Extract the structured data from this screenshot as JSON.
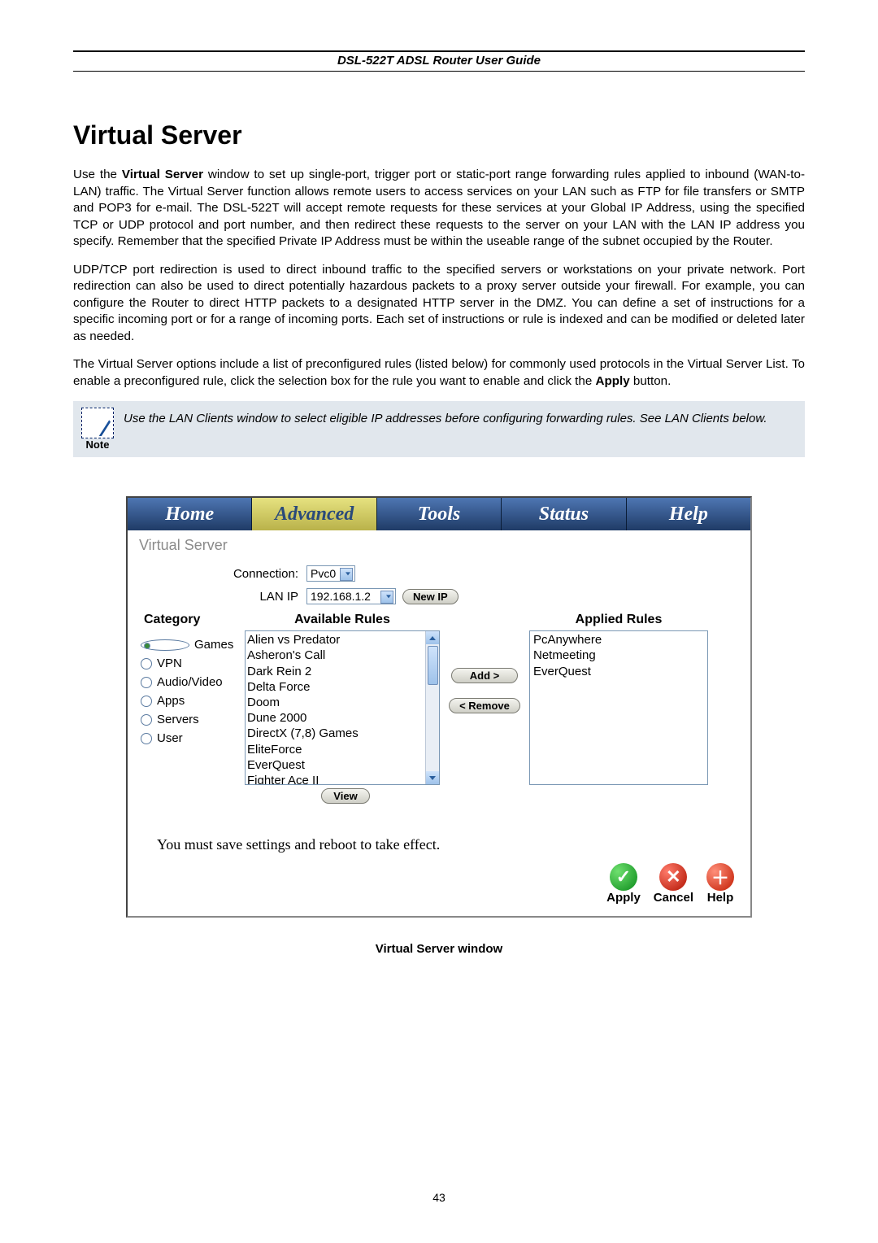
{
  "header": {
    "title": "DSL-522T ADSL Router User Guide"
  },
  "section": {
    "heading": "Virtual Server"
  },
  "paragraphs": {
    "p1a": "Use the ",
    "p1b": "Virtual Server",
    "p1c": " window to set up single-port, trigger port or static-port range forwarding rules applied to inbound (WAN-to-LAN) traffic. The Virtual Server function allows remote users to access services on your LAN such as FTP for file transfers or SMTP and POP3 for e-mail. The DSL-522T will accept remote requests for these services at your Global IP Address, using the specified TCP or UDP protocol and port number, and then redirect these requests to the server on your LAN with the LAN IP address you specify. Remember that the specified Private IP Address must be within the useable range of the subnet occupied by the Router.",
    "p2": "UDP/TCP port redirection is used to direct inbound traffic to the specified servers or workstations on your private network. Port redirection can also be used to direct potentially hazardous packets to a proxy server outside your firewall. For example, you can configure the Router to direct HTTP packets to a designated HTTP server in the DMZ. You can define a set of instructions for a specific incoming port or for a range of incoming ports. Each set of instructions or rule is indexed and can be modified or deleted later as needed.",
    "p3a": "The Virtual Server options include a list of preconfigured rules (listed below) for commonly used protocols in the Virtual Server List. To enable a preconfigured rule, click the selection box for the rule you want to enable and click the ",
    "p3b": "Apply",
    "p3c": " button."
  },
  "note": {
    "label": "Note",
    "text": "Use the LAN Clients window to select eligible IP addresses before configuring forwarding rules. See LAN Clients below."
  },
  "tabs": [
    "Home",
    "Advanced",
    "Tools",
    "Status",
    "Help"
  ],
  "panel": {
    "title": "Virtual Server",
    "connection_label": "Connection:",
    "connection_value": "Pvc0",
    "lanip_label": "LAN IP",
    "lanip_value": "192.168.1.2",
    "newip_button": "New IP",
    "headers": {
      "category": "Category",
      "available": "Available Rules",
      "applied": "Applied Rules"
    },
    "categories": [
      {
        "label": "Games",
        "selected": true
      },
      {
        "label": "VPN",
        "selected": false
      },
      {
        "label": "Audio/Video",
        "selected": false
      },
      {
        "label": "Apps",
        "selected": false
      },
      {
        "label": "Servers",
        "selected": false
      },
      {
        "label": "User",
        "selected": false
      }
    ],
    "available_rules": [
      "Alien vs Predator",
      "Asheron's Call",
      "Dark Rein 2",
      "Delta Force",
      "Doom",
      "Dune 2000",
      "DirectX (7,8) Games",
      "EliteForce",
      "EverQuest",
      "Fighter Ace II"
    ],
    "applied_rules": [
      "PcAnywhere",
      "Netmeeting",
      "EverQuest"
    ],
    "add_button": "Add >",
    "remove_button": "< Remove",
    "view_button": "View",
    "save_msg": "You must save settings and reboot to take effect.",
    "actions": {
      "apply": "Apply",
      "cancel": "Cancel",
      "help": "Help"
    }
  },
  "caption": "Virtual Server window",
  "page_number": "43"
}
